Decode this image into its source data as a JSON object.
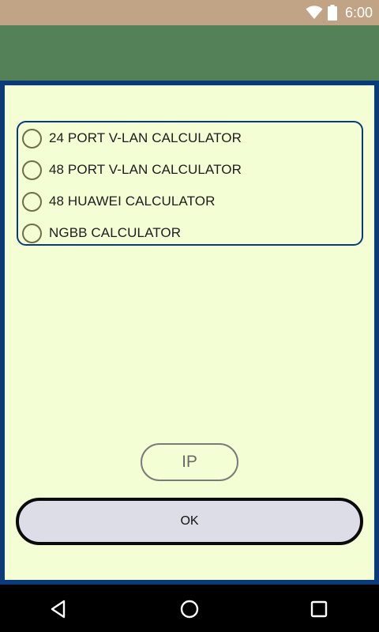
{
  "status_bar": {
    "time": "6:00",
    "icons": [
      "wifi-icon",
      "battery-icon"
    ]
  },
  "calculator_options": [
    {
      "label": "24 PORT V-LAN CALCULATOR",
      "selected": false
    },
    {
      "label": "48 PORT V-LAN CALCULATOR",
      "selected": false
    },
    {
      "label": "48 HUAWEI CALCULATOR",
      "selected": false
    },
    {
      "label": "NGBB CALCULATOR",
      "selected": false
    }
  ],
  "buttons": {
    "ip_label": "IP",
    "ok_label": "OK"
  },
  "nav_bar": {
    "icons": [
      "back-icon",
      "home-icon",
      "recents-icon"
    ]
  },
  "colors": {
    "status_bar": "#c1a486",
    "app_bar": "#548158",
    "content_background": "#f4fed4",
    "frame_border": "#0b3a78",
    "ok_button_fill": "#dcdde7"
  }
}
